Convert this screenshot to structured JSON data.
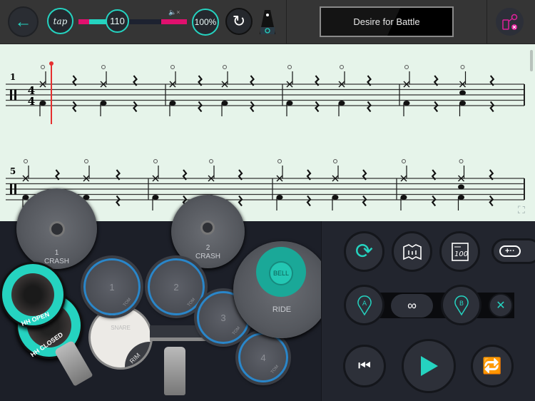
{
  "topbar": {
    "tap_label": "tap",
    "tempo_value": "110",
    "tempo_progress": 0.42,
    "volume_progress": 0.25,
    "speed_value": "100%",
    "song_title": "Desire for Battle"
  },
  "sheet": {
    "time_signature": {
      "top": "4",
      "bottom": "4"
    },
    "systems": [
      {
        "measure_number": "1",
        "measures": [
          [
            "hh",
            "rest",
            "hh",
            "rest"
          ],
          [
            "hh",
            "rest",
            "hh",
            "rest"
          ],
          [
            "hh",
            "rest",
            "hh",
            "rest"
          ],
          [
            "hh",
            "rest",
            "hhsnare",
            "rest"
          ]
        ]
      },
      {
        "measure_number": "5",
        "measures": [
          [
            "hh",
            "rest",
            "hh",
            "rest"
          ],
          [
            "hh",
            "rest",
            "hh",
            "rest"
          ],
          [
            "hh",
            "rest",
            "hh",
            "rest"
          ],
          [
            "hh",
            "rest",
            "hhsnare",
            "rest"
          ]
        ]
      }
    ],
    "playhead_measure_beat": 0
  },
  "drumkit": {
    "crash1": {
      "number": "1",
      "label": "CRASH"
    },
    "crash2": {
      "number": "2",
      "label": "CRASH"
    },
    "hh_open": "HH OPEN",
    "hh_closed": "HH CLOSED",
    "tom1": "1",
    "tom2": "2",
    "tom3": "3",
    "tom4": "4",
    "tom_label": "TOM",
    "snare": "SNARE",
    "rim": "RIM",
    "ride": "RIDE",
    "bell": "BELL"
  },
  "controls": {
    "point_a": "A",
    "point_b": "B"
  },
  "colors": {
    "accent": "#25d3c0",
    "magenta": "#e0106e",
    "tom_ring": "#2a86c9"
  }
}
